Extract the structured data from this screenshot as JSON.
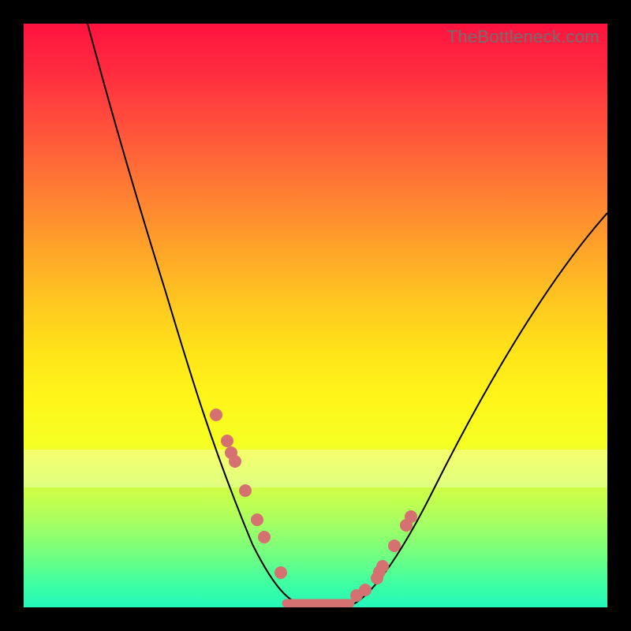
{
  "watermark": "TheBottleneck.com",
  "chart_data": {
    "type": "line",
    "title": "",
    "xlabel": "",
    "ylabel": "",
    "xlim": [
      0,
      100
    ],
    "ylim": [
      0,
      100
    ],
    "series": [
      {
        "name": "bottleneck-curve",
        "x": [
          11,
          15,
          20,
          25,
          30,
          33,
          36,
          38,
          40,
          42,
          44,
          46,
          48,
          50,
          53,
          56,
          60,
          64,
          68,
          72,
          76,
          80,
          85,
          90,
          95,
          100
        ],
        "y": [
          100,
          86,
          70,
          55,
          41,
          33,
          26,
          20,
          15,
          10,
          6,
          2.5,
          0,
          0,
          0,
          0,
          4,
          10,
          17,
          24,
          31,
          38,
          46,
          54,
          61,
          68
        ]
      }
    ],
    "markers": {
      "name": "sample-points",
      "x": [
        33.0,
        34.8,
        35.6,
        36.2,
        38.0,
        40.0,
        41.2,
        44.0,
        57.0,
        58.5,
        60.5,
        61.0,
        61.5,
        63.5,
        65.5,
        66.3
      ],
      "y": [
        33.0,
        28.5,
        26.5,
        25.0,
        20.0,
        15.0,
        12.0,
        6.0,
        2.0,
        3.0,
        5.0,
        6.0,
        7.0,
        10.5,
        14.0,
        15.5
      ]
    },
    "flat_segment": {
      "x0": 45,
      "x1": 56,
      "y": 0
    },
    "pale_band_y": [
      21,
      27
    ],
    "colors": {
      "curve": "#000000",
      "markers": "#d57171",
      "gradient_top": "#ff133f",
      "gradient_bottom": "#23f7b9"
    }
  }
}
